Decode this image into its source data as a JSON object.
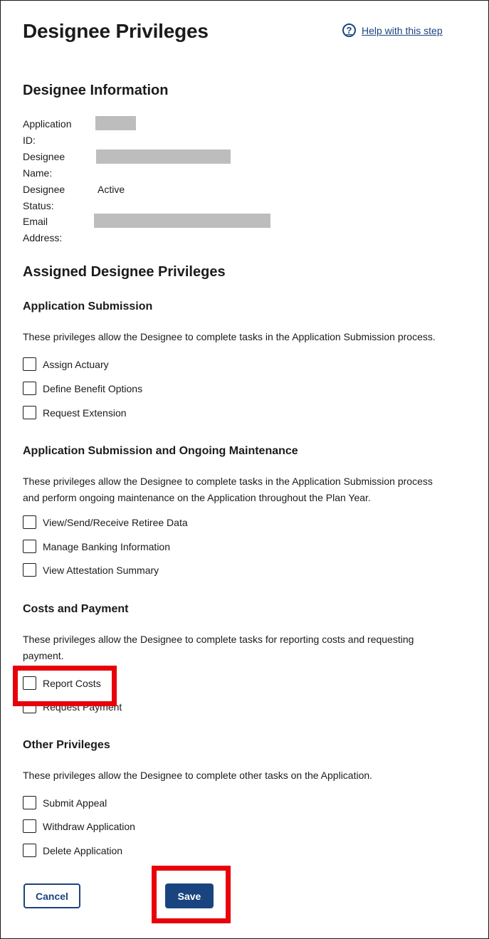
{
  "page": {
    "title": "Designee Privileges",
    "help_link": "Help with this step"
  },
  "designee_info": {
    "heading": "Designee Information",
    "fields": [
      {
        "label": "Application ID:",
        "value": "",
        "redacted": true
      },
      {
        "label": "Designee Name:",
        "value": "",
        "redacted": true
      },
      {
        "label": "Designee Status:",
        "value": "Active",
        "redacted": false
      },
      {
        "label": "Email Address:",
        "value": "",
        "redacted": true
      }
    ]
  },
  "privileges": {
    "heading": "Assigned Designee Privileges",
    "sections": [
      {
        "title": "Application Submission",
        "description": "These privileges allow the Designee to complete tasks in the Application Submission process.",
        "items": [
          {
            "label": "Assign Actuary",
            "checked": false
          },
          {
            "label": "Define Benefit Options",
            "checked": false
          },
          {
            "label": "Request Extension",
            "checked": false
          }
        ]
      },
      {
        "title": "Application Submission and Ongoing Maintenance",
        "description": "These privileges allow the Designee to complete tasks in the Application Submission process and perform ongoing maintenance on the Application throughout the Plan Year.",
        "items": [
          {
            "label": "View/Send/Receive Retiree Data",
            "checked": false
          },
          {
            "label": "Manage Banking Information",
            "checked": false
          },
          {
            "label": "View Attestation Summary",
            "checked": false
          }
        ]
      },
      {
        "title": "Costs and Payment",
        "description": "These privileges allow the Designee to complete tasks for reporting costs and requesting payment.",
        "items": [
          {
            "label": "Report Costs",
            "checked": false
          },
          {
            "label": "Request Payment",
            "checked": false
          }
        ]
      },
      {
        "title": "Other Privileges",
        "description": "These privileges allow the Designee to complete other tasks on the Application.",
        "items": [
          {
            "label": "Submit Appeal",
            "checked": false
          },
          {
            "label": "Withdraw Application",
            "checked": false
          },
          {
            "label": "Delete Application",
            "checked": false
          }
        ]
      }
    ]
  },
  "actions": {
    "cancel_label": "Cancel",
    "save_label": "Save"
  },
  "colors": {
    "primary": "#1a4480",
    "highlight": "#e8000b",
    "redaction": "#bdbdbd"
  }
}
